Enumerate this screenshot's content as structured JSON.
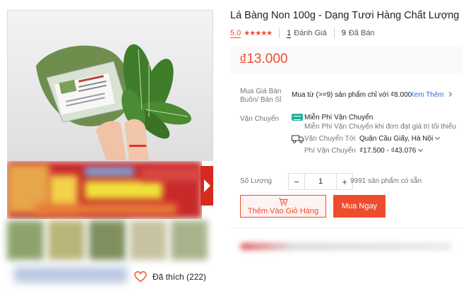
{
  "product": {
    "title": "Lá Bàng Non 100g - Dạng Tươi Hàng Chất Lượng",
    "rating": "5.0",
    "stars": "★★★★★",
    "rating_count": "1",
    "rating_label": "Đánh Giá",
    "sold_count": "9",
    "sold_label": "Đã Bán",
    "price_currency": "đ",
    "price": "13.000"
  },
  "wholesale": {
    "label_line1": "Mua Giá Bán",
    "label_line2": "Buôn/ Bán Sỉ",
    "text": "Mua từ (>=9) sản phẩm chỉ với ₫8.000",
    "link": "Xem Thêm",
    "link_icon": "chevron-right-icon"
  },
  "shipping": {
    "label": "Vận Chuyển",
    "free_title": "Miễn Phí Vận Chuyển",
    "free_desc": "Miễn Phí Vận Chuyển khi đơn đạt giá trị tối thiểu",
    "to_label": "Vận Chuyển Tới",
    "to_value": "Quận Cầu Giấy, Hà Nội",
    "fee_label": "Phí Vận Chuyển",
    "fee_value": "₫17.500 - ₫43.076"
  },
  "quantity": {
    "label": "Số Lượng",
    "minus": "−",
    "value": "1",
    "plus": "+",
    "stock": "9991 sản phẩm có sẵn"
  },
  "actions": {
    "add_to_cart": "Thêm Vào Giỏ Hàng",
    "buy_now": "Mua Ngay"
  },
  "gallery": {
    "like_label": "Đã thích (222)"
  },
  "colors": {
    "accent": "#ee4d2d",
    "link": "#2e6ac9",
    "free_ship_badge": "#1fb39a"
  }
}
